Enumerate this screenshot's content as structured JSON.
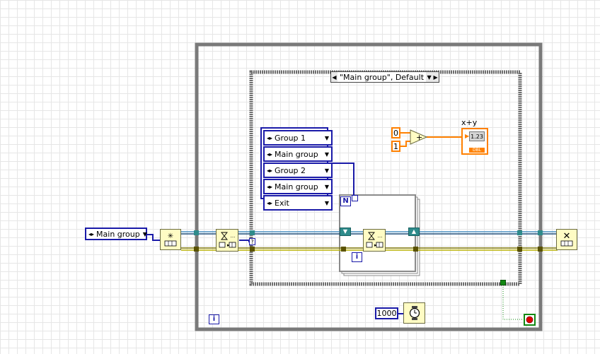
{
  "case_structure": {
    "selector_text": "\"Main group\", Default"
  },
  "queue_control": {
    "label": "Main group"
  },
  "array_constant": {
    "items": [
      "Group 1",
      "Main group",
      "Group 2",
      "Main group",
      "Exit"
    ]
  },
  "for_loop": {
    "count_terminal": "N",
    "iteration_terminal": "i"
  },
  "while_loop": {
    "iteration_terminal": "i"
  },
  "add_function": {
    "input_a": "0",
    "input_b": "1",
    "symbol": "+",
    "output_label": "x+y",
    "indicator_text": "1.23",
    "indicator_type": "DBL"
  },
  "wait": {
    "ms_value": "1000"
  },
  "colors": {
    "loop_border": "#7a7a7a",
    "enum_blue": "#1a1aa8",
    "queue_wire": "#4a90c2",
    "error_wire": "#7c7400",
    "numeric_orange": "#ff8000",
    "stop_red": "#e00000",
    "subvi_bg": "#fffcc4"
  },
  "icons": {
    "obtain_queue": "obtain-queue-icon",
    "dequeue": "dequeue-element-icon",
    "enqueue": "enqueue-element-icon",
    "release_queue": "release-queue-icon",
    "wait_ms": "wait-ms-icon",
    "stop": "stop-terminal-icon"
  }
}
